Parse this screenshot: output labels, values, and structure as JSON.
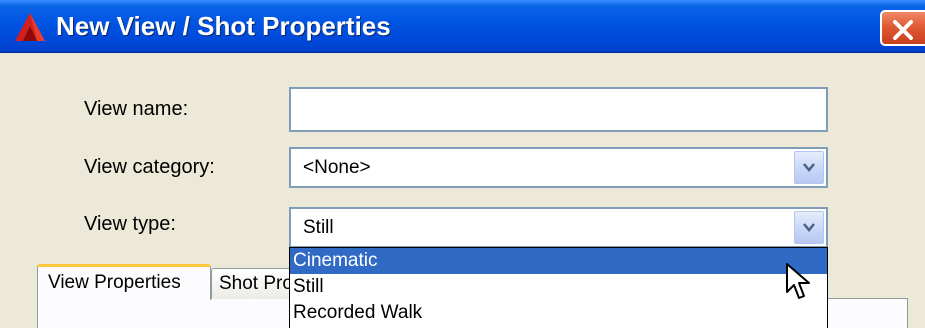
{
  "window": {
    "title": "New View / Shot Properties",
    "title_bar_color": "#0054e3",
    "close_button_color": "#e05a32"
  },
  "form": {
    "view_name": {
      "label": "View name:",
      "value": ""
    },
    "view_category": {
      "label": "View category:",
      "value": "<None>"
    },
    "view_type": {
      "label": "View type:",
      "value": "Still"
    }
  },
  "tabs": [
    {
      "label": "View Properties",
      "active": true
    },
    {
      "label": "Shot Properties",
      "active": false
    }
  ],
  "view_type_dropdown": {
    "options": [
      {
        "label": "Cinematic",
        "highlighted": true
      },
      {
        "label": "Still",
        "highlighted": false
      },
      {
        "label": "Recorded Walk",
        "highlighted": false
      }
    ],
    "highlight_color": "#316ac5"
  },
  "icons": {
    "app": "autocad-logo-icon",
    "close": "close-icon",
    "dropdown": "chevron-down-icon",
    "pointer": "mouse-cursor-icon"
  }
}
